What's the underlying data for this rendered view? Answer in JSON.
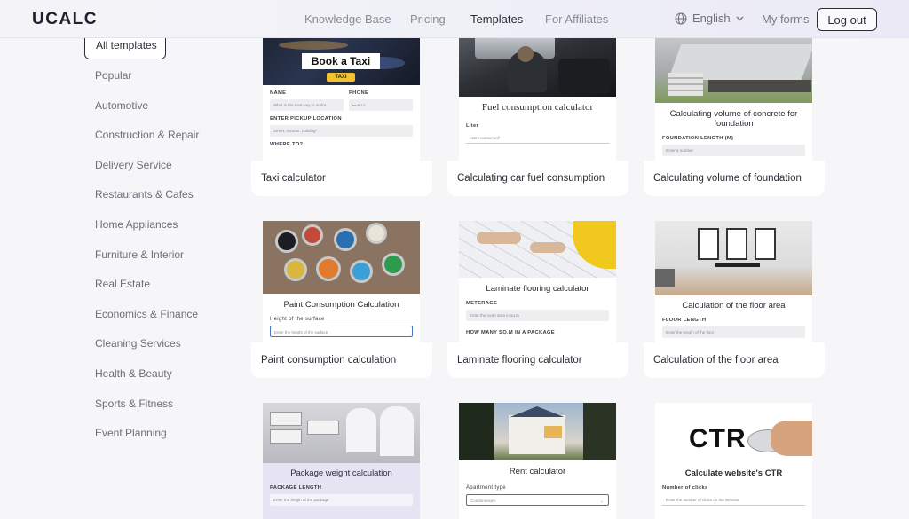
{
  "header": {
    "logo": "UCALC",
    "nav": [
      "Knowledge Base",
      "Pricing",
      "Templates",
      "For Affiliates"
    ],
    "language": "English",
    "my_forms": "My forms",
    "logout": "Log out"
  },
  "sidebar": {
    "items": [
      "All templates",
      "Popular",
      "Automotive",
      "Construction & Repair",
      "Delivery Service",
      "Restaurants & Cafes",
      "Home Appliances",
      "Furniture & Interior",
      "Real Estate",
      "Economics & Finance",
      "Cleaning Services",
      "Health & Beauty",
      "Sports & Fitness",
      "Event Planning"
    ]
  },
  "cards": [
    {
      "caption": "Taxi calculator",
      "banner": "Book a Taxi",
      "badge": "TAXI",
      "labels": [
        "NAME",
        "PHONE",
        "ENTER PICKUP LOCATION",
        "WHERE TO?"
      ],
      "placeholders": [
        "What is the best way to addre",
        "+1",
        "Street, number, building*"
      ]
    },
    {
      "caption": "Calculating car fuel consumption",
      "title": "Fuel consumption calculator",
      "label": "Liter",
      "placeholder": "Liters consumed*"
    },
    {
      "caption": "Calculating volume of foundation",
      "title": "Calculating volume of concrete for foundation",
      "label": "FOUNDATION LENGTH (M)",
      "placeholder": "Enter a number"
    },
    {
      "caption": "Paint consumption calculation",
      "title": "Paint Consumption Calculation",
      "label": "Height of the surface",
      "placeholder": "Enter the height of the surface"
    },
    {
      "caption": "Laminate flooring calculator",
      "title": "Laminate flooring calculator",
      "label": "METERAGE",
      "placeholder": "Enter the room area in sq.m",
      "label2": "HOW MANY SQ.M IN A PACKAGE"
    },
    {
      "caption": "Calculation of the floor area",
      "title": "Calculation of the floor area",
      "label": "FLOOR LENGTH",
      "placeholder": "Enter the length of the floor"
    },
    {
      "caption": "",
      "title": "Package weight calculation",
      "label": "PACKAGE LENGTH",
      "placeholder": "Enter the length of the package"
    },
    {
      "caption": "",
      "title": "Rent calculator",
      "label": "Apartment type",
      "select_value": "Condominium"
    },
    {
      "caption": "",
      "title": "Calculate website's CTR",
      "image_text": "CTR",
      "label": "Number of clicks",
      "placeholder": "Enter the number of clicks on the website"
    }
  ],
  "colors": {
    "accent": "#2b2d36",
    "header_bg": "#efeff7",
    "page_bg": "#f6f6f8"
  }
}
